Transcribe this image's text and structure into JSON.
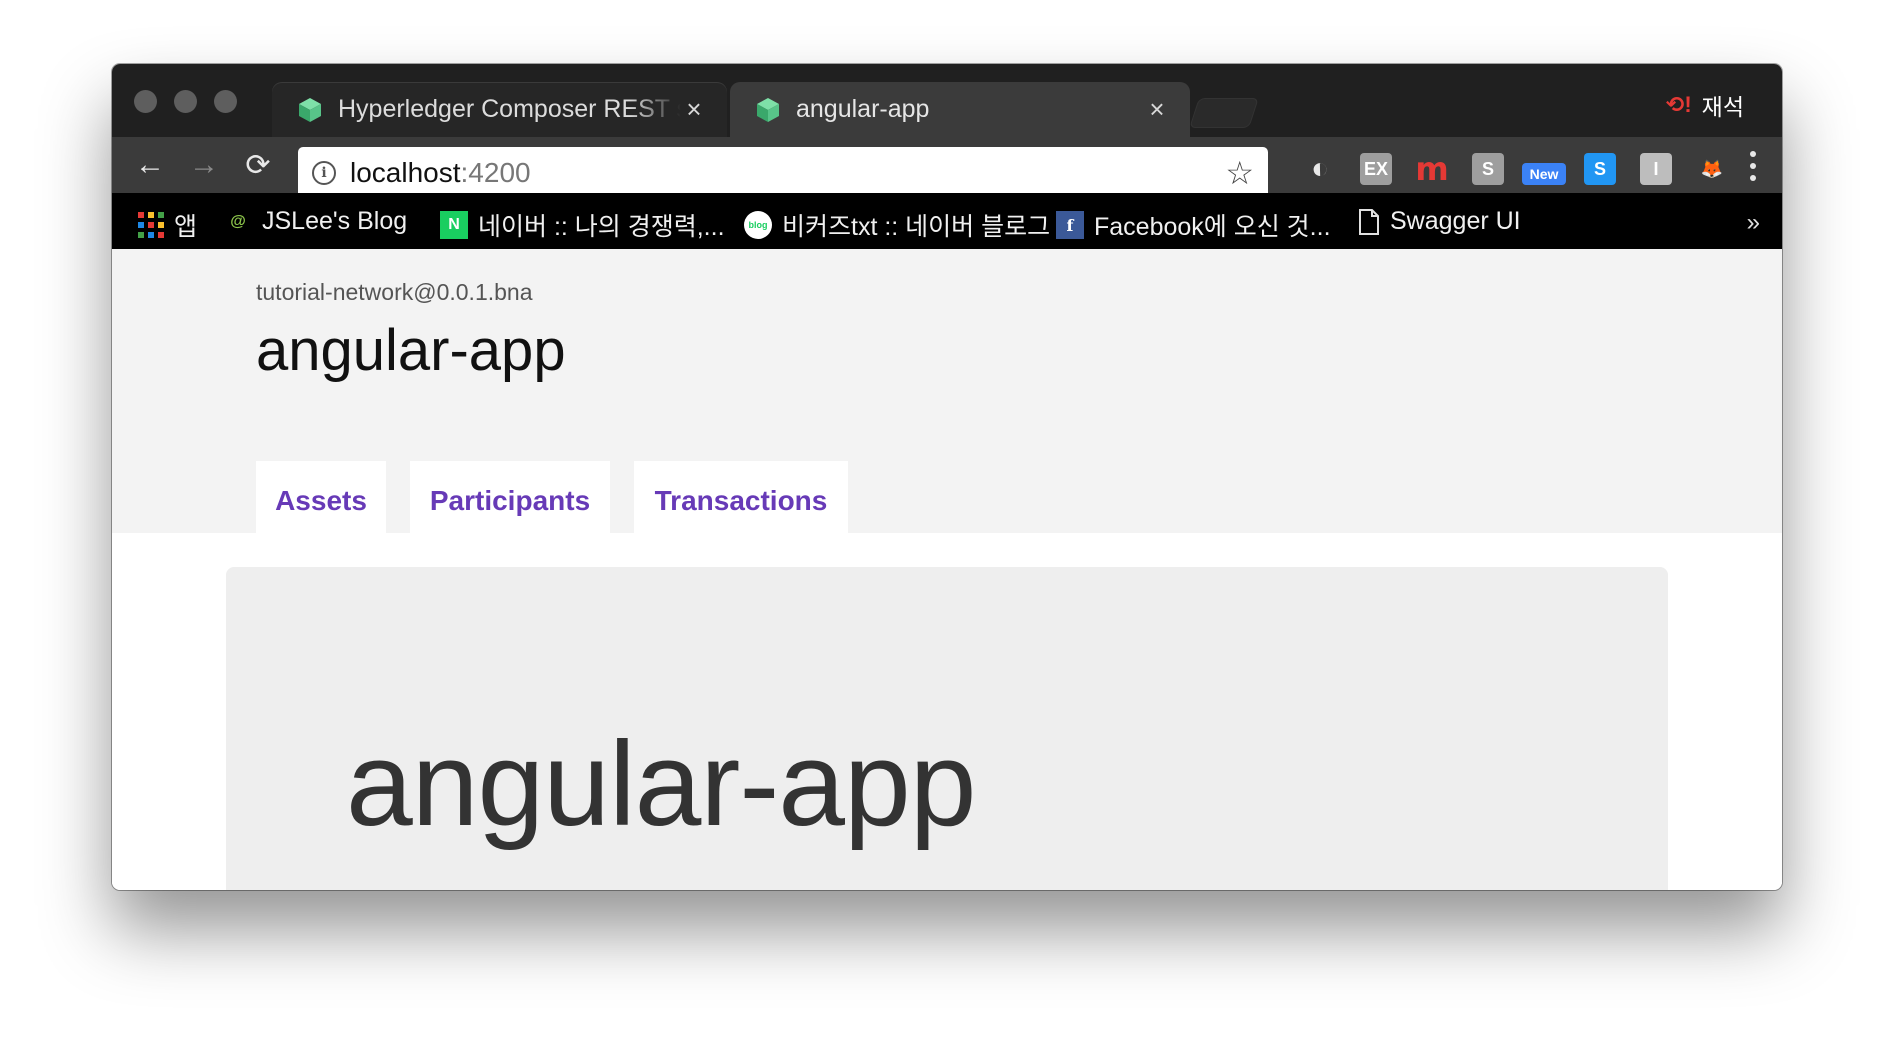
{
  "tabs": [
    {
      "title": "Hyperledger Composer REST server",
      "close": "×",
      "active": false
    },
    {
      "title": "angular-app",
      "close": "×",
      "active": true
    }
  ],
  "profile": {
    "name": "재석",
    "icon": "sync-error-icon"
  },
  "toolbar": {
    "url_host": "localhost",
    "url_port": ":4200",
    "back_icon": "←",
    "forward_icon": "→",
    "reload_icon": "⟳",
    "info_icon": "i",
    "star_icon": "☆",
    "extensions": [
      {
        "name": "contrast-icon",
        "label": "◐",
        "color": "#e8e8e8",
        "bg": "transparent"
      },
      {
        "name": "ex-icon",
        "label": "EX",
        "color": "#ffffff",
        "bg": "#9e9e9e"
      },
      {
        "name": "m-icon",
        "label": "m",
        "color": "#e53935",
        "bg": "transparent"
      },
      {
        "name": "s-grey-icon",
        "label": "S",
        "color": "#ffffff",
        "bg": "#9e9e9e"
      },
      {
        "name": "new-badge-icon",
        "label": "New",
        "color": "#ffffff",
        "bg": "#3b82f6"
      },
      {
        "name": "s-blue-icon",
        "label": "S",
        "color": "#ffffff",
        "bg": "#2196f3"
      },
      {
        "name": "i-grey-icon",
        "label": "I",
        "color": "#ffffff",
        "bg": "#bdbdbd"
      },
      {
        "name": "fox-icon",
        "label": "🦊",
        "color": "#f57c00",
        "bg": "transparent"
      }
    ]
  },
  "bookmarks": [
    {
      "label": "앱",
      "icon": "apps-grid-icon"
    },
    {
      "label": "JSLee's Blog",
      "icon": "snail-icon"
    },
    {
      "label": "네이버 :: 나의 경쟁력,...",
      "icon": "naver-icon"
    },
    {
      "label": "비커즈txt :: 네이버 블로그",
      "icon": "blog-icon"
    },
    {
      "label": "Facebook에 오신 것...",
      "icon": "facebook-icon"
    },
    {
      "label": "Swagger UI",
      "icon": "page-icon"
    }
  ],
  "bookmarks_more": "»",
  "page": {
    "network": "tutorial-network@0.0.1.bna",
    "title": "angular-app",
    "nav": [
      "Assets",
      "Participants",
      "Transactions"
    ],
    "jumbotron_title": "angular-app"
  },
  "colors": {
    "accent": "#673ab7",
    "header_bg": "#f3f3f3",
    "jumbotron_bg": "#eeeeee"
  }
}
